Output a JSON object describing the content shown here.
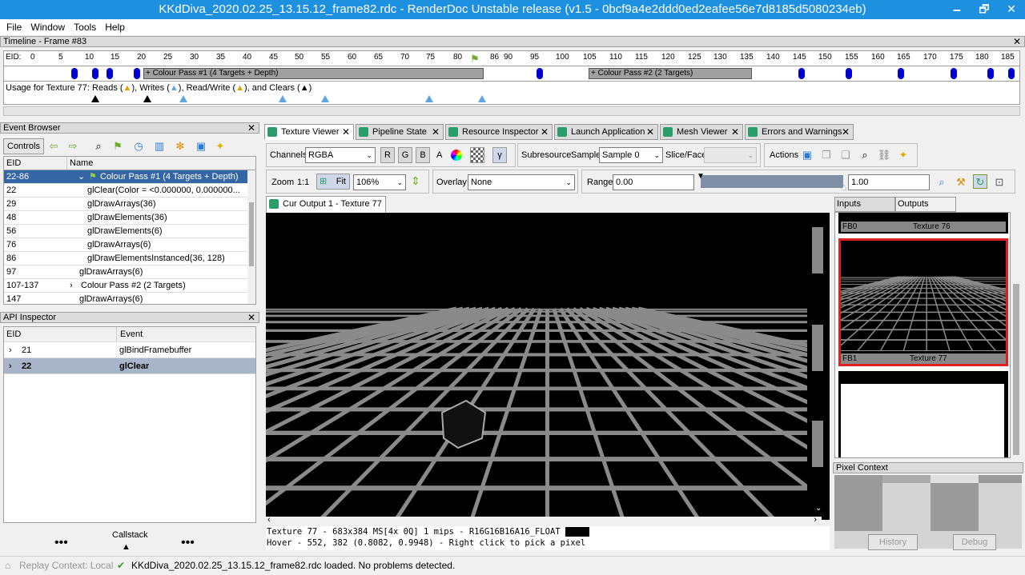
{
  "window": {
    "title": "KKdDiva_2020.02.25_13.15.12_frame82.rdc - RenderDoc Unstable release (v1.5 - 0bcf9a4e2ddd0ed2eafee56e7d8185d5080234eb)",
    "minimize": "🗕",
    "maximize": "🗗",
    "close": "✕"
  },
  "menu": [
    "File",
    "Window",
    "Tools",
    "Help"
  ],
  "timeline": {
    "title": "Timeline - Frame #83",
    "eid_label": "EID:",
    "ticks": [
      "0",
      "5",
      "10",
      "15",
      "20",
      "25",
      "30",
      "35",
      "40",
      "45",
      "50",
      "55",
      "60",
      "65",
      "70",
      "75",
      "80",
      "86",
      "90",
      "95",
      "100",
      "105",
      "110",
      "115",
      "120",
      "125",
      "130",
      "135",
      "140",
      "145",
      "150",
      "155",
      "160",
      "165",
      "170",
      "175",
      "180",
      "185"
    ],
    "pass1": "+ Colour Pass #1 (4 Targets + Depth)",
    "pass2": "+ Colour Pass #2 (2 Targets)",
    "usage_prefix": "Usage for Texture 77: Reads (",
    "usage_reads": "), Writes (",
    "usage_writes": "), Read/Write (",
    "usage_rw": "), and Clears (",
    "usage_end": ")"
  },
  "event_browser": {
    "title": "Event Browser",
    "controls_label": "Controls",
    "col_eid": "EID",
    "col_name": "Name",
    "rows": [
      {
        "eid": "22-86",
        "name": "Colour Pass #1 (4 Targets + Depth)",
        "indent": 1,
        "expander": "⌄",
        "flag": true,
        "selected": true
      },
      {
        "eid": "22",
        "name": "glClear(Color = <0.000000, 0.000000...",
        "indent": 2
      },
      {
        "eid": "29",
        "name": "glDrawArrays(36)",
        "indent": 2
      },
      {
        "eid": "48",
        "name": "glDrawElements(36)",
        "indent": 2
      },
      {
        "eid": "56",
        "name": "glDrawElements(6)",
        "indent": 2
      },
      {
        "eid": "76",
        "name": "glDrawArrays(6)",
        "indent": 2
      },
      {
        "eid": "86",
        "name": "glDrawElementsInstanced(36, 128)",
        "indent": 2
      },
      {
        "eid": "97",
        "name": "glDrawArrays(6)",
        "indent": 1
      },
      {
        "eid": "107-137",
        "name": "Colour Pass #2 (2 Targets)",
        "indent": 0,
        "expander": "›"
      },
      {
        "eid": "147",
        "name": "glDrawArrays(6)",
        "indent": 1
      }
    ]
  },
  "api_inspector": {
    "title": "API Inspector",
    "col_eid": "EID",
    "col_event": "Event",
    "rows": [
      {
        "eid": "21",
        "event": "glBindFramebuffer",
        "selected": false
      },
      {
        "eid": "22",
        "event": "glClear",
        "selected": true
      }
    ],
    "callstack": "Callstack",
    "dots": "•••"
  },
  "tabs": [
    "Texture Viewer",
    "Pipeline State",
    "Resource Inspector",
    "Launch Application",
    "Mesh Viewer",
    "Errors and Warnings"
  ],
  "tab_close": "✕",
  "toolbar": {
    "channels_label": "Channels",
    "channels_value": "RGBA",
    "r": "R",
    "g": "G",
    "b": "B",
    "a": "A",
    "gamma": "γ",
    "subresource_label": "Subresource",
    "sample_label": "Sample",
    "sample_value": "Sample 0",
    "slice_label": "Slice/Face",
    "actions_label": "Actions",
    "zoom_label": "Zoom",
    "zoom_11": "1:1",
    "fit": "Fit",
    "zoom_value": "106%",
    "overlay_label": "Overlay",
    "overlay_value": "None",
    "range_label": "Range",
    "range_min": "0.00",
    "range_max": "1.00"
  },
  "output_tab": "Cur Output 1 - Texture 77",
  "status_lines": {
    "line1": "Texture 77 - 683x384 MS[4x 0Q] 1 mips - R16G16B16A16_FLOAT",
    "line2": "Hover -  552,  382 (0.8082, 0.9948) - Right click to pick a pixel"
  },
  "side": {
    "inputs": "Inputs",
    "outputs": "Outputs",
    "fb0": "FB0",
    "fb0_tex": "Texture 76",
    "fb1": "FB1",
    "fb1_tex": "Texture 77",
    "pixel_context": "Pixel Context",
    "history": "History",
    "debug": "Debug"
  },
  "statusbar": {
    "replay": "Replay Context: Local",
    "message": "KKdDiva_2020.02.25_13.15.12_frame82.rdc loaded. No problems detected."
  },
  "colors": {
    "titlebar": "#1e90e0",
    "selection": "#3465a4",
    "accent_red": "#e02020"
  }
}
